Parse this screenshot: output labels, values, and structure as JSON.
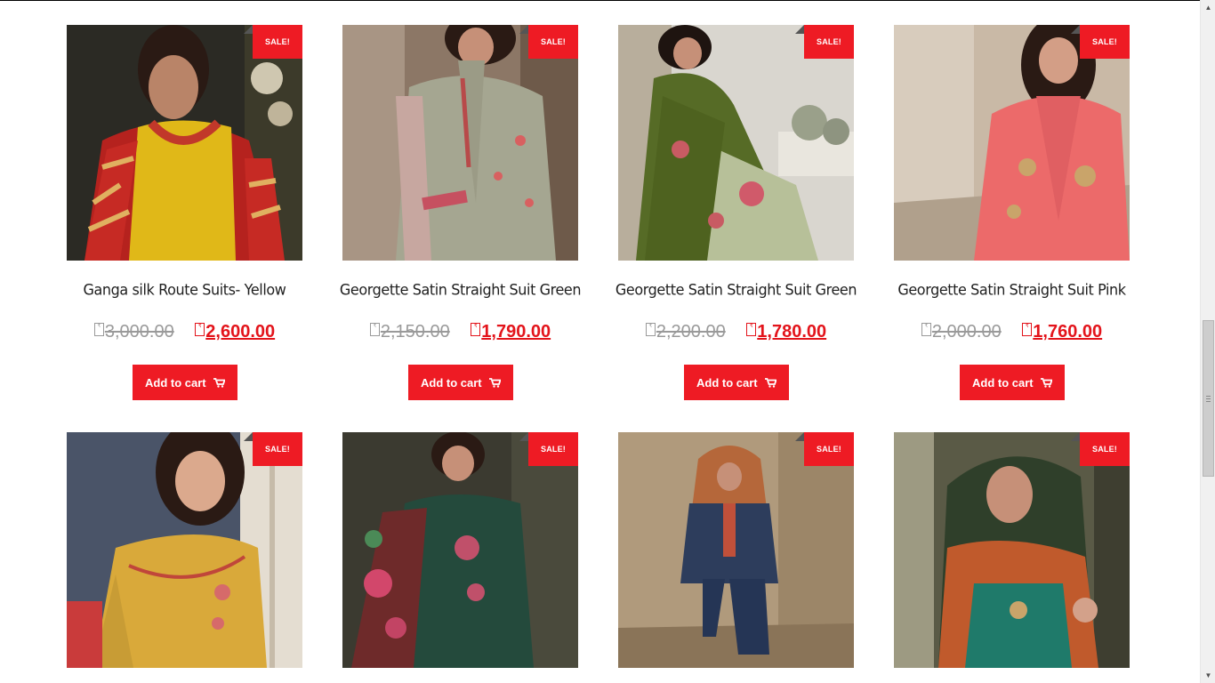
{
  "products_row1": [
    {
      "title": "Ganga silk Route Suits- Yellow",
      "old_price": "3,000.00",
      "new_price": "2,600.00",
      "badge": "SALE!",
      "button": "Add to cart"
    },
    {
      "title": "Georgette Satin Straight Suit Green",
      "old_price": "2,150.00",
      "new_price": "1,790.00",
      "badge": "SALE!",
      "button": "Add to cart"
    },
    {
      "title": "Georgette Satin Straight Suit Green",
      "old_price": "2,200.00",
      "new_price": "1,780.00",
      "badge": "SALE!",
      "button": "Add to cart"
    },
    {
      "title": "Georgette Satin Straight Suit Pink",
      "old_price": "2,000.00",
      "new_price": "1,760.00",
      "badge": "SALE!",
      "button": "Add to cart"
    }
  ],
  "products_row2": [
    {
      "badge": "SALE!"
    },
    {
      "badge": "SALE!"
    },
    {
      "badge": "SALE!"
    },
    {
      "badge": "SALE!"
    }
  ],
  "currency_glyph": "₹",
  "colors": {
    "accent": "#ee1b24",
    "price_new": "#e3141b",
    "price_old": "#9a9a9a",
    "title": "#1f1f1f"
  },
  "icons": {
    "cart": "cart-icon"
  }
}
